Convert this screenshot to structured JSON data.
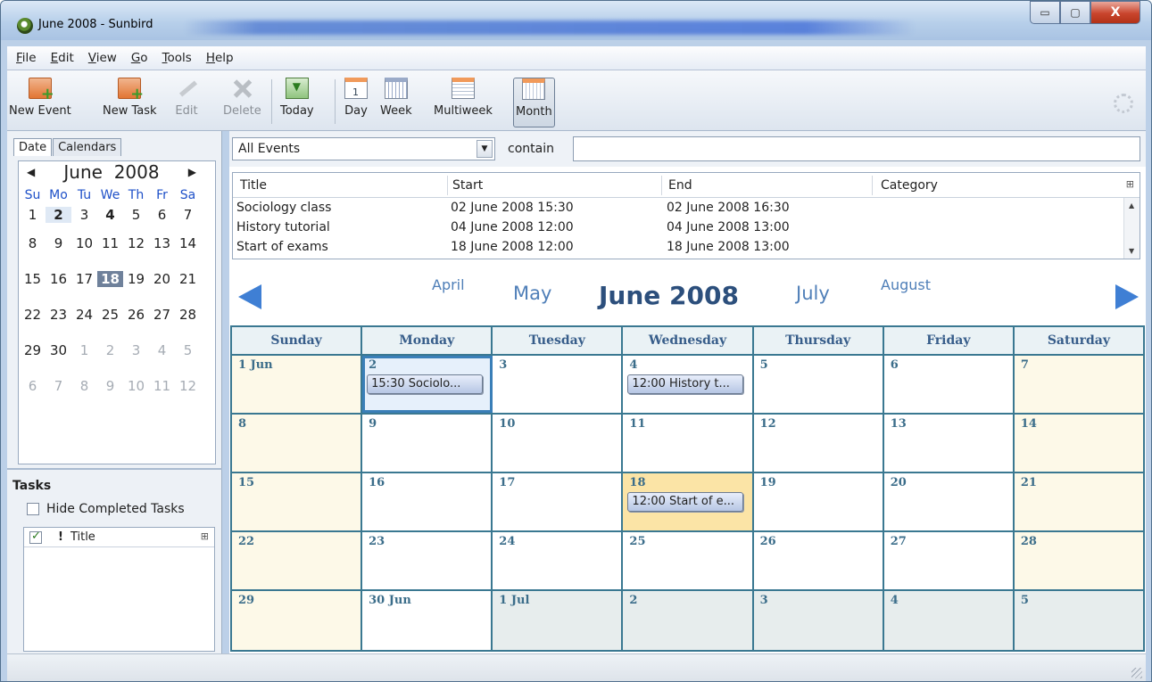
{
  "window": {
    "title": "June 2008 - Sunbird",
    "controls": {
      "minimize": "▭",
      "maximize": "▢",
      "close": "X"
    }
  },
  "menu": [
    {
      "label": "File",
      "key": "F",
      "rest": "ile"
    },
    {
      "label": "Edit",
      "key": "E",
      "rest": "dit"
    },
    {
      "label": "View",
      "key": "V",
      "rest": "iew"
    },
    {
      "label": "Go",
      "key": "G",
      "rest": "o"
    },
    {
      "label": "Tools",
      "key": "T",
      "rest": "ools"
    },
    {
      "label": "Help",
      "key": "H",
      "rest": "elp"
    }
  ],
  "toolbar": {
    "new_event": "New Event",
    "new_task": "New Task",
    "edit": "Edit",
    "delete": "Delete",
    "today": "Today",
    "day": "Day",
    "week": "Week",
    "multiweek": "Multiweek",
    "month": "Month"
  },
  "left_tabs": {
    "date": "Date",
    "calendars": "Calendars"
  },
  "minimonth": {
    "month": "June",
    "year": "2008",
    "prev": "◀",
    "next": "▶",
    "dow": [
      "Su",
      "Mo",
      "Tu",
      "We",
      "Th",
      "Fr",
      "Sa"
    ],
    "weeks": [
      [
        "1",
        "2",
        "3",
        "4",
        "5",
        "6",
        "7"
      ],
      [
        "8",
        "9",
        "10",
        "11",
        "12",
        "13",
        "14"
      ],
      [
        "15",
        "16",
        "17",
        "18",
        "19",
        "20",
        "21"
      ],
      [
        "22",
        "23",
        "24",
        "25",
        "26",
        "27",
        "28"
      ],
      [
        "29",
        "30",
        "1",
        "2",
        "3",
        "4",
        "5"
      ],
      [
        "6",
        "7",
        "8",
        "9",
        "10",
        "11",
        "12"
      ]
    ]
  },
  "tasks": {
    "header": "Tasks",
    "hide_completed": "Hide Completed Tasks",
    "priority_col": "!",
    "title_col": "Title",
    "col_picker": "⊞"
  },
  "filter": {
    "selected": "All Events",
    "dropdown_arrow": "▼",
    "contain_label": "contain",
    "search_value": ""
  },
  "event_list": {
    "columns": [
      "Title",
      "Start",
      "End",
      "Category"
    ],
    "col_picker": "⊞",
    "rows": [
      {
        "title": "Sociology class",
        "start": "02 June 2008 15:30",
        "end": "02 June 2008 16:30",
        "category": ""
      },
      {
        "title": "History tutorial",
        "start": "04 June 2008 12:00",
        "end": "04 June 2008 13:00",
        "category": ""
      },
      {
        "title": "Start of exams",
        "start": "18 June 2008 12:00",
        "end": "18 June 2008 13:00",
        "category": ""
      }
    ],
    "scroll_up": "▲",
    "scroll_down": "▼"
  },
  "month_header": {
    "prev2": "April",
    "prev1": "May",
    "current": "June 2008",
    "next1": "July",
    "next2": "August"
  },
  "month_grid": {
    "dow": [
      "Sunday",
      "Monday",
      "Tuesday",
      "Wednesday",
      "Thursday",
      "Friday",
      "Saturday"
    ],
    "weeks": [
      [
        "1 Jun",
        "2",
        "3",
        "4",
        "5",
        "6",
        "7"
      ],
      [
        "8",
        "9",
        "10",
        "11",
        "12",
        "13",
        "14"
      ],
      [
        "15",
        "16",
        "17",
        "18",
        "19",
        "20",
        "21"
      ],
      [
        "22",
        "23",
        "24",
        "25",
        "26",
        "27",
        "28"
      ],
      [
        "29",
        "30 Jun",
        "1 Jul",
        "2",
        "3",
        "4",
        "5"
      ]
    ],
    "events": {
      "sociology": "15:30 Sociolo...",
      "history": "12:00 History t...",
      "exams": "12:00 Start of e..."
    }
  },
  "colors": {
    "accent": "#3a7891",
    "today": "#fbe4a6",
    "weekend": "#fdf9e8",
    "other_month": "#e7eded",
    "nav_arrow": "#3f7fd4"
  }
}
